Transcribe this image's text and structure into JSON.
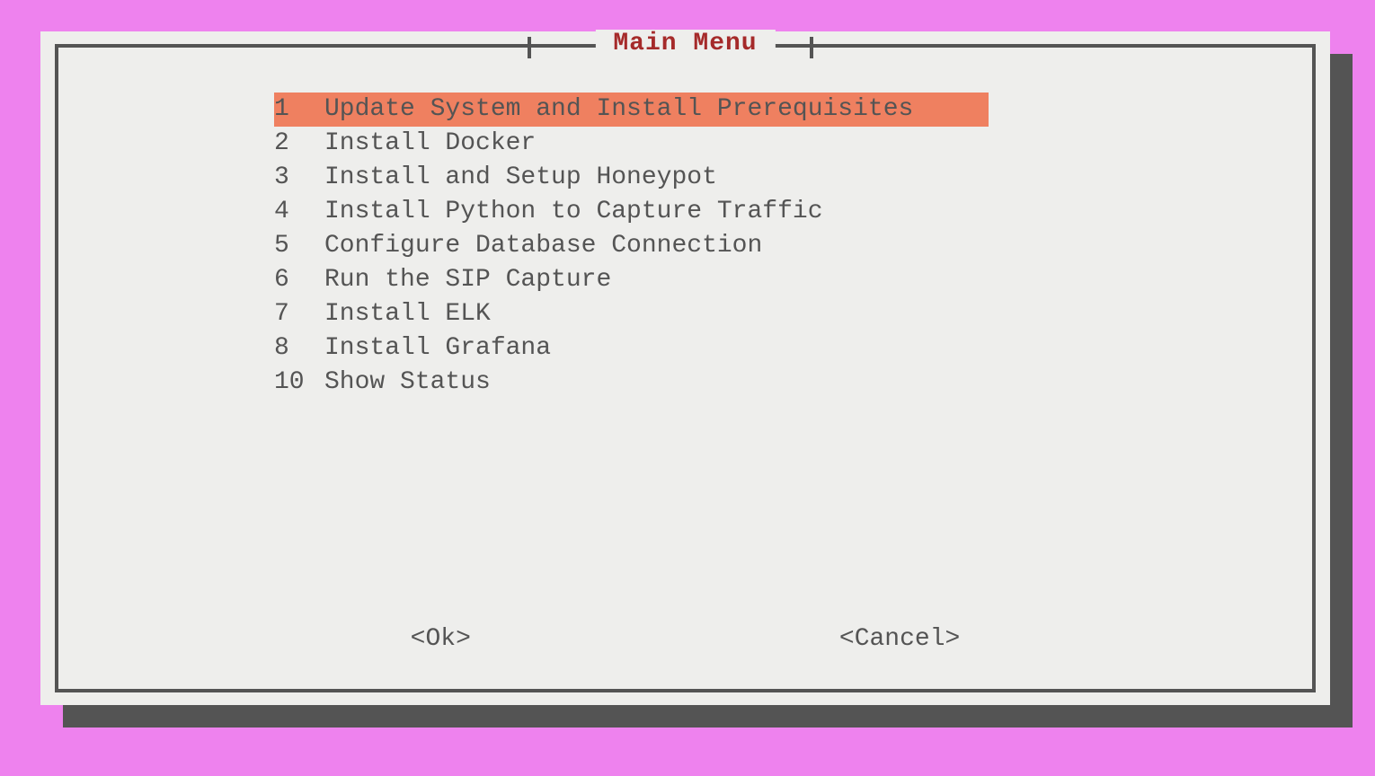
{
  "title": "Main Menu",
  "menu_items": [
    {
      "number": "1",
      "label": "Update System and Install Prerequisites",
      "selected": true
    },
    {
      "number": "2",
      "label": "Install Docker",
      "selected": false
    },
    {
      "number": "3",
      "label": "Install and Setup Honeypot",
      "selected": false
    },
    {
      "number": "4",
      "label": "Install Python to Capture Traffic",
      "selected": false
    },
    {
      "number": "5",
      "label": "Configure Database Connection",
      "selected": false
    },
    {
      "number": "6",
      "label": "Run the SIP Capture",
      "selected": false
    },
    {
      "number": "7",
      "label": "Install ELK",
      "selected": false
    },
    {
      "number": "8",
      "label": "Install Grafana",
      "selected": false
    },
    {
      "number": "10",
      "label": "Show Status",
      "selected": false
    }
  ],
  "buttons": {
    "ok": "<Ok>",
    "cancel": "<Cancel>"
  }
}
